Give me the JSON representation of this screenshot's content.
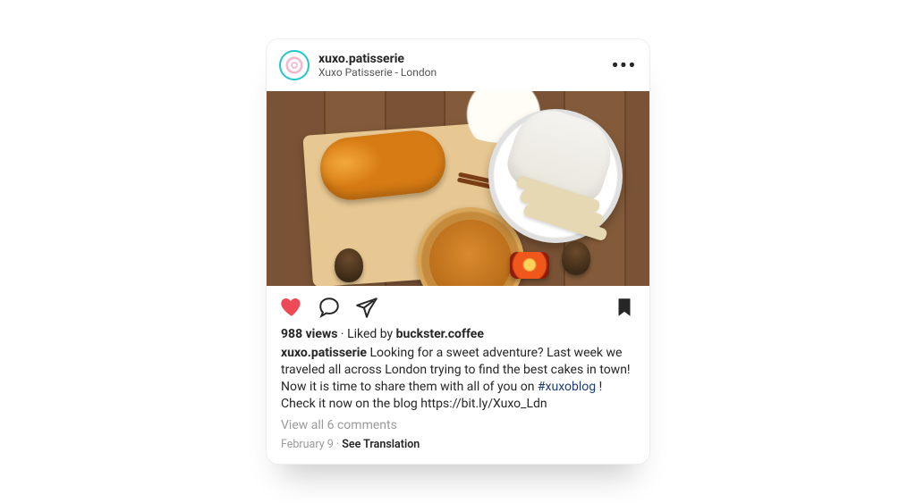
{
  "header": {
    "username": "xuxo.patisserie",
    "location": "Xuxo Patisserie - London"
  },
  "post": {
    "views_count": "988",
    "views_label": "views",
    "liked_by_prefix": "Liked by",
    "liked_by_name": "buckster.coffee",
    "author": "xuxo.patisserie",
    "caption_before_tag": "Looking for a sweet adventure? Last week we traveled all across London trying to find the best cakes in town! Now it is time to share them with all of you on ",
    "hashtag": "#xuxoblog",
    "caption_after_tag": "! Check it now on the blog https://bit.ly/Xuxo_Ldn",
    "comments_link": "View all 6 comments",
    "date": "February 9",
    "see_translation": "See Translation",
    "separator": "·"
  },
  "colors": {
    "like_active": "#ed4956"
  }
}
